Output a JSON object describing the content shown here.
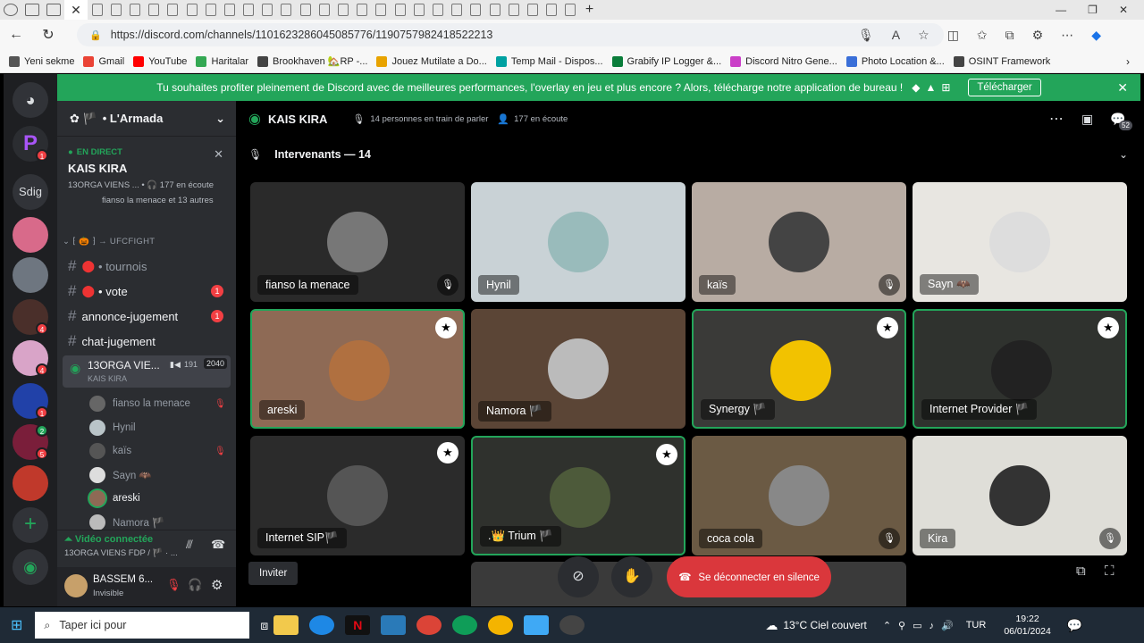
{
  "browser": {
    "tabs_count": 26,
    "url": "https://discord.com/channels/1101623286045085776/1190757982418522213",
    "bookmarks": [
      "Yeni sekme",
      "Gmail",
      "YouTube",
      "Haritalar",
      "Brookhaven 🏡RP -...",
      "Jouez Mutilate a Do...",
      "Temp Mail - Dispos...",
      "Grabify IP Logger &...",
      "Discord Nitro Gene...",
      "Photo Location &...",
      "OSINT Framework"
    ]
  },
  "banner": {
    "text": "Tu souhaites profiter pleinement de Discord avec de meilleures performances, l'overlay en jeu et plus encore ? Alors, télécharge notre application de bureau !",
    "button": "Télécharger"
  },
  "guilds": {
    "sdig": "Sdig",
    "badges": [
      "1",
      "4",
      "4",
      "1",
      "2",
      "5"
    ]
  },
  "sidebar": {
    "server_name": "• L'Armada",
    "live": {
      "tag": "EN DIRECT",
      "title": "KAIS KIRA",
      "sub": "13ORGA VIENS ... • 🎧 177 en écoute",
      "users": "fianso la menace et 13 autres"
    },
    "category": "→ UFCFIGHT",
    "channels": [
      {
        "name": "• tournois",
        "badge": ""
      },
      {
        "name": "• vote",
        "badge": "1"
      },
      {
        "name": "annonce-jugement",
        "badge": "1"
      },
      {
        "name": "chat-jugement",
        "badge": ""
      }
    ],
    "stage": {
      "name": "13ORGA VIE...",
      "sub": "KAIS KIRA",
      "count1": "191",
      "count2": "2040"
    },
    "voice_users": [
      "fianso la menace",
      "Hynil",
      "kaïs",
      "Sayn 🦇",
      "areski",
      "Namora 🏴"
    ],
    "video": {
      "title": "Vidéo connectée",
      "sub": "13ORGA VIENS FDP / 🏴 · ..."
    },
    "user": {
      "name": "BASSEM 6...",
      "status": "Invisible"
    }
  },
  "header": {
    "title": "KAIS KIRA",
    "speaking": "14 personnes en train de parler",
    "listening": "177 en écoute",
    "inbox": "52"
  },
  "speakers_title": "Intervenants — 14",
  "tiles": [
    {
      "label": "fianso la menace",
      "bg": "#2a2a2a",
      "av": "#777",
      "mic": true,
      "star": false,
      "speaking": false
    },
    {
      "label": "Hynil",
      "bg": "#c9d2d6",
      "av": "#9bb",
      "mic": false,
      "star": false,
      "speaking": false
    },
    {
      "label": "kaïs",
      "bg": "#b8aca3",
      "av": "#444",
      "mic": true,
      "star": false,
      "speaking": false
    },
    {
      "label": "Sayn 🦇",
      "bg": "#e8e6e1",
      "av": "#ddd",
      "mic": false,
      "star": false,
      "speaking": false
    },
    {
      "label": "areski",
      "bg": "#8e6a55",
      "av": "#b07040",
      "mic": false,
      "star": true,
      "speaking": true
    },
    {
      "label": "Namora 🏴",
      "bg": "#5b4536",
      "av": "#bbb",
      "mic": false,
      "star": false,
      "speaking": false
    },
    {
      "label": "Synergy 🏴",
      "bg": "#3a3a38",
      "av": "#f2c200",
      "mic": false,
      "star": true,
      "speaking": true
    },
    {
      "label": "Internet Provider 🏴",
      "bg": "#2f322e",
      "av": "#222",
      "mic": false,
      "star": true,
      "speaking": true
    },
    {
      "label": "Internet SIP🏴",
      "bg": "#2b2b2b",
      "av": "#555",
      "mic": false,
      "star": true,
      "speaking": false
    },
    {
      "label": ".👑 Trium 🏴",
      "bg": "#2f312d",
      "av": "#4d5a3a",
      "mic": false,
      "star": true,
      "speaking": true
    },
    {
      "label": "coca cola",
      "bg": "#6b5a44",
      "av": "#888",
      "mic": true,
      "star": false,
      "speaking": false
    },
    {
      "label": "Kira",
      "bg": "#dfded8",
      "av": "#333",
      "mic": true,
      "star": false,
      "speaking": false
    }
  ],
  "controls": {
    "invite": "Inviter",
    "disconnect": "Se déconnecter en silence"
  },
  "taskbar": {
    "search": "Taper ici pour",
    "weather": "13°C  Ciel couvert",
    "lang": "TUR",
    "time": "19:22",
    "date": "06/01/2024"
  },
  "colors": {
    "discord_green": "#23a55a",
    "red": "#da373c",
    "blurple": "#5865f2"
  }
}
